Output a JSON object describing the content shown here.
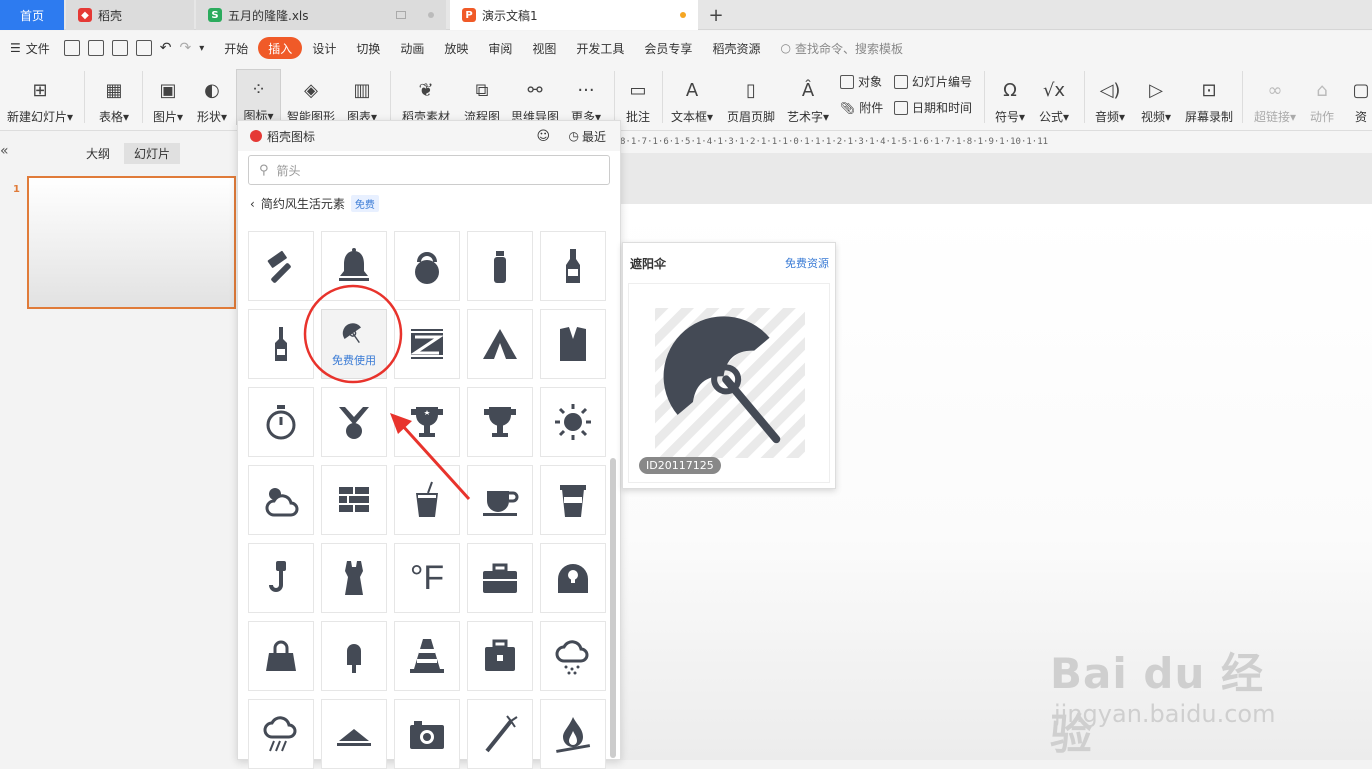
{
  "tabs": {
    "home": "首页",
    "daoke": "稻壳",
    "xls": "五月的隆隆.xls",
    "ppt": "演示文稿1",
    "add": "+"
  },
  "menu": {
    "file": "文件",
    "items": [
      "开始",
      "插入",
      "设计",
      "切换",
      "动画",
      "放映",
      "审阅",
      "视图",
      "开发工具",
      "会员专享",
      "稻壳资源"
    ],
    "active_index": 1,
    "search_placeholder": "查找命令、搜索模板"
  },
  "ribbon": {
    "new_slide": "新建幻灯片",
    "table": "表格",
    "picture": "图片",
    "shape": "形状",
    "icon": "图标",
    "smartart": "智能图形",
    "chart": "图表",
    "daoke_assets": "稻壳素材",
    "flowchart": "流程图",
    "mindmap": "思维导图",
    "more": "更多",
    "comment": "批注",
    "textbox": "文本框",
    "header_footer": "页眉页脚",
    "wordart": "艺术字",
    "object": "对象",
    "attachment": "附件",
    "slide_number": "幻灯片编号",
    "datetime": "日期和时间",
    "symbol": "符号",
    "formula": "公式",
    "audio": "音频",
    "video": "视频",
    "screen_record": "屏幕录制",
    "hyperlink": "超链接",
    "action": "动作",
    "resource": "资"
  },
  "left_panel": {
    "collapse": "«",
    "outline": "大纲",
    "slides": "幻灯片",
    "slide_number": "1"
  },
  "ruler": "8·1·7·1·6·1·5·1·4·1·3·1·2·1·1·1·0·1·1·1·2·1·3·1·4·1·5·1·6·1·7·1·8·1·9·1·10·1·11",
  "icon_panel": {
    "title": "稻壳图标",
    "recent": "最近",
    "search_placeholder": "箭头",
    "category": "简约风生活元素",
    "free_badge": "免费",
    "hover_label": "免费使用",
    "icons": [
      [
        "hammer",
        "bell",
        "kettlebell",
        "bottle",
        "beer-bottle"
      ],
      [
        "wine-bottle",
        "umbrella",
        "film",
        "tent",
        "suit"
      ],
      [
        "stopwatch",
        "medal",
        "trophy-star",
        "trophy",
        "sun"
      ],
      [
        "weather-cloudy-sun",
        "bricks",
        "drink-cup",
        "coffee-cup",
        "coffee-takeaway"
      ],
      [
        "crane-hook",
        "tank-top",
        "fahrenheit",
        "toolbox",
        "bag"
      ],
      [
        "handbag",
        "popsicle",
        "traffic-cone",
        "briefcase",
        "cloud-rain"
      ],
      [
        "cloud-storm",
        "hat",
        "camera",
        "firework",
        "campfire"
      ]
    ],
    "fahrenheit_text": "°F"
  },
  "preview": {
    "title": "遮阳伞",
    "free_link": "免费资源",
    "id": "ID20117125"
  },
  "watermark": {
    "brand": "Bai du 经验",
    "url": "jingyan.baidu.com"
  },
  "colors": {
    "accent": "#f05a28",
    "blue": "#2d7bf0",
    "annot": "#e8332c",
    "icon": "#444a55"
  }
}
